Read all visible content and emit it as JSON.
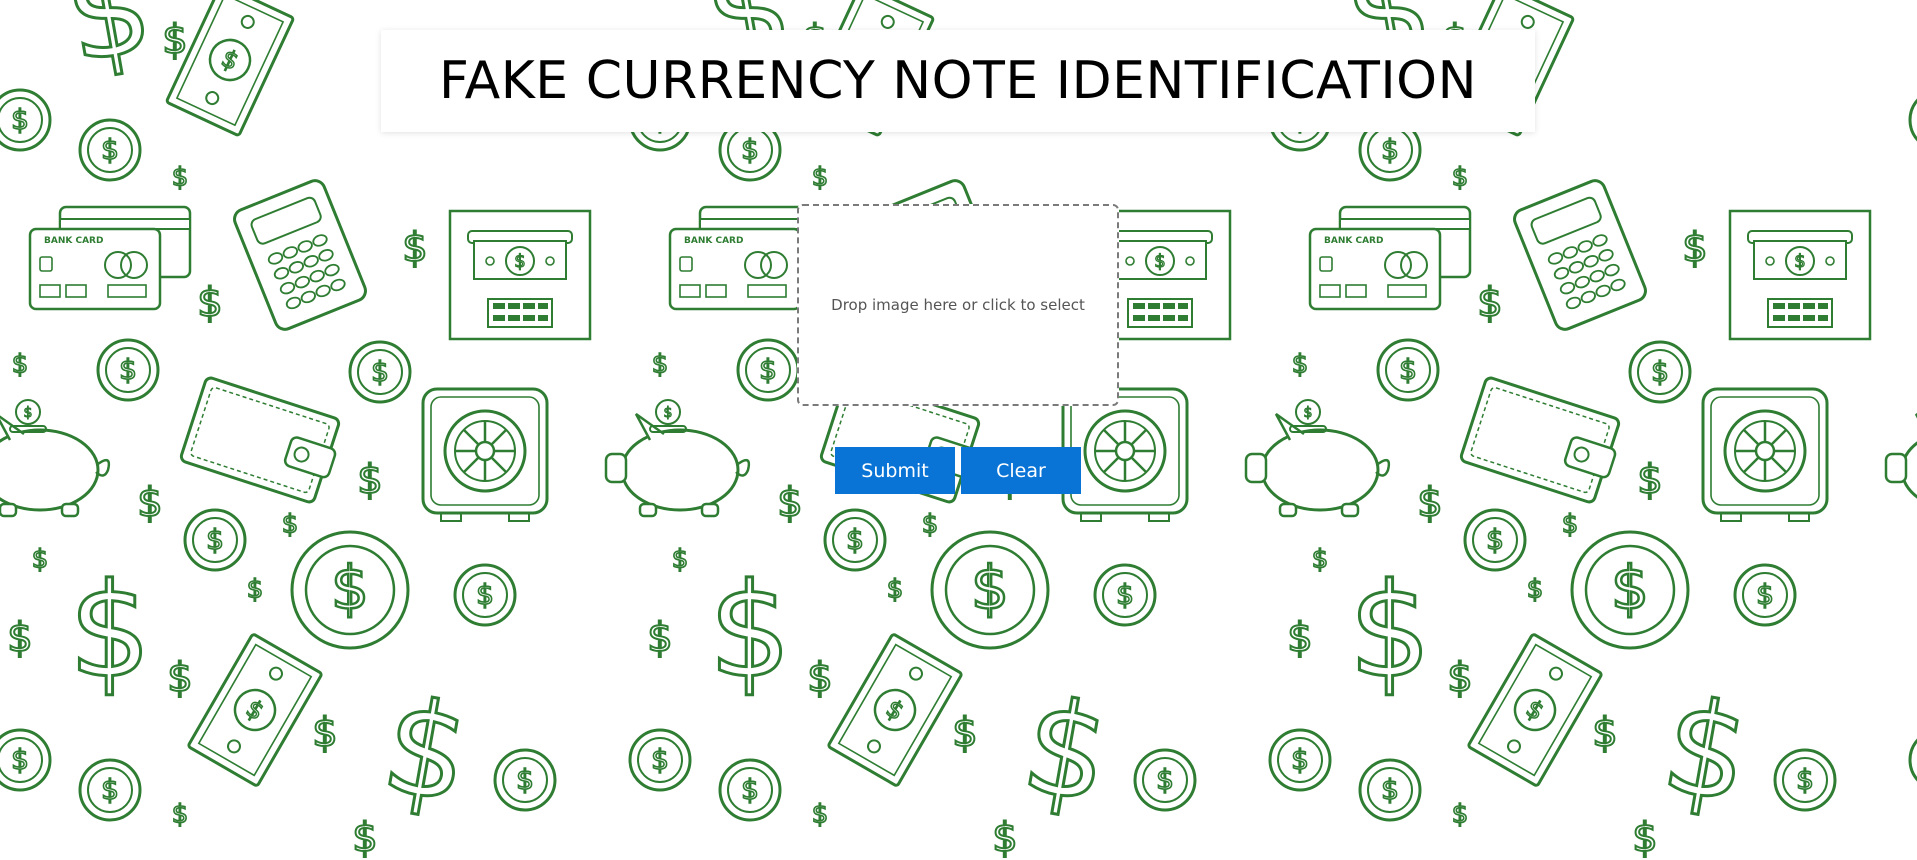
{
  "page": {
    "title": "FAKE CURRENCY NOTE IDENTIFICATION"
  },
  "upload": {
    "prompt": "Drop image here or click to select"
  },
  "actions": {
    "submit_label": "Submit",
    "clear_label": "Clear"
  },
  "background": {
    "pattern": "money-doodle-pattern",
    "icons": [
      "dollar-sign-icon",
      "coin-icon",
      "banknote-icon",
      "bank-card-icon",
      "calculator-icon",
      "atm-icon",
      "wallet-icon",
      "piggy-bank-icon",
      "safe-icon"
    ],
    "card_label": "BANK CARD",
    "stroke_color": "#2e7d32",
    "fill_color": "#ffffff"
  },
  "colors": {
    "button": "#0a74d6",
    "button_text": "#ffffff",
    "title_text": "#000000"
  }
}
